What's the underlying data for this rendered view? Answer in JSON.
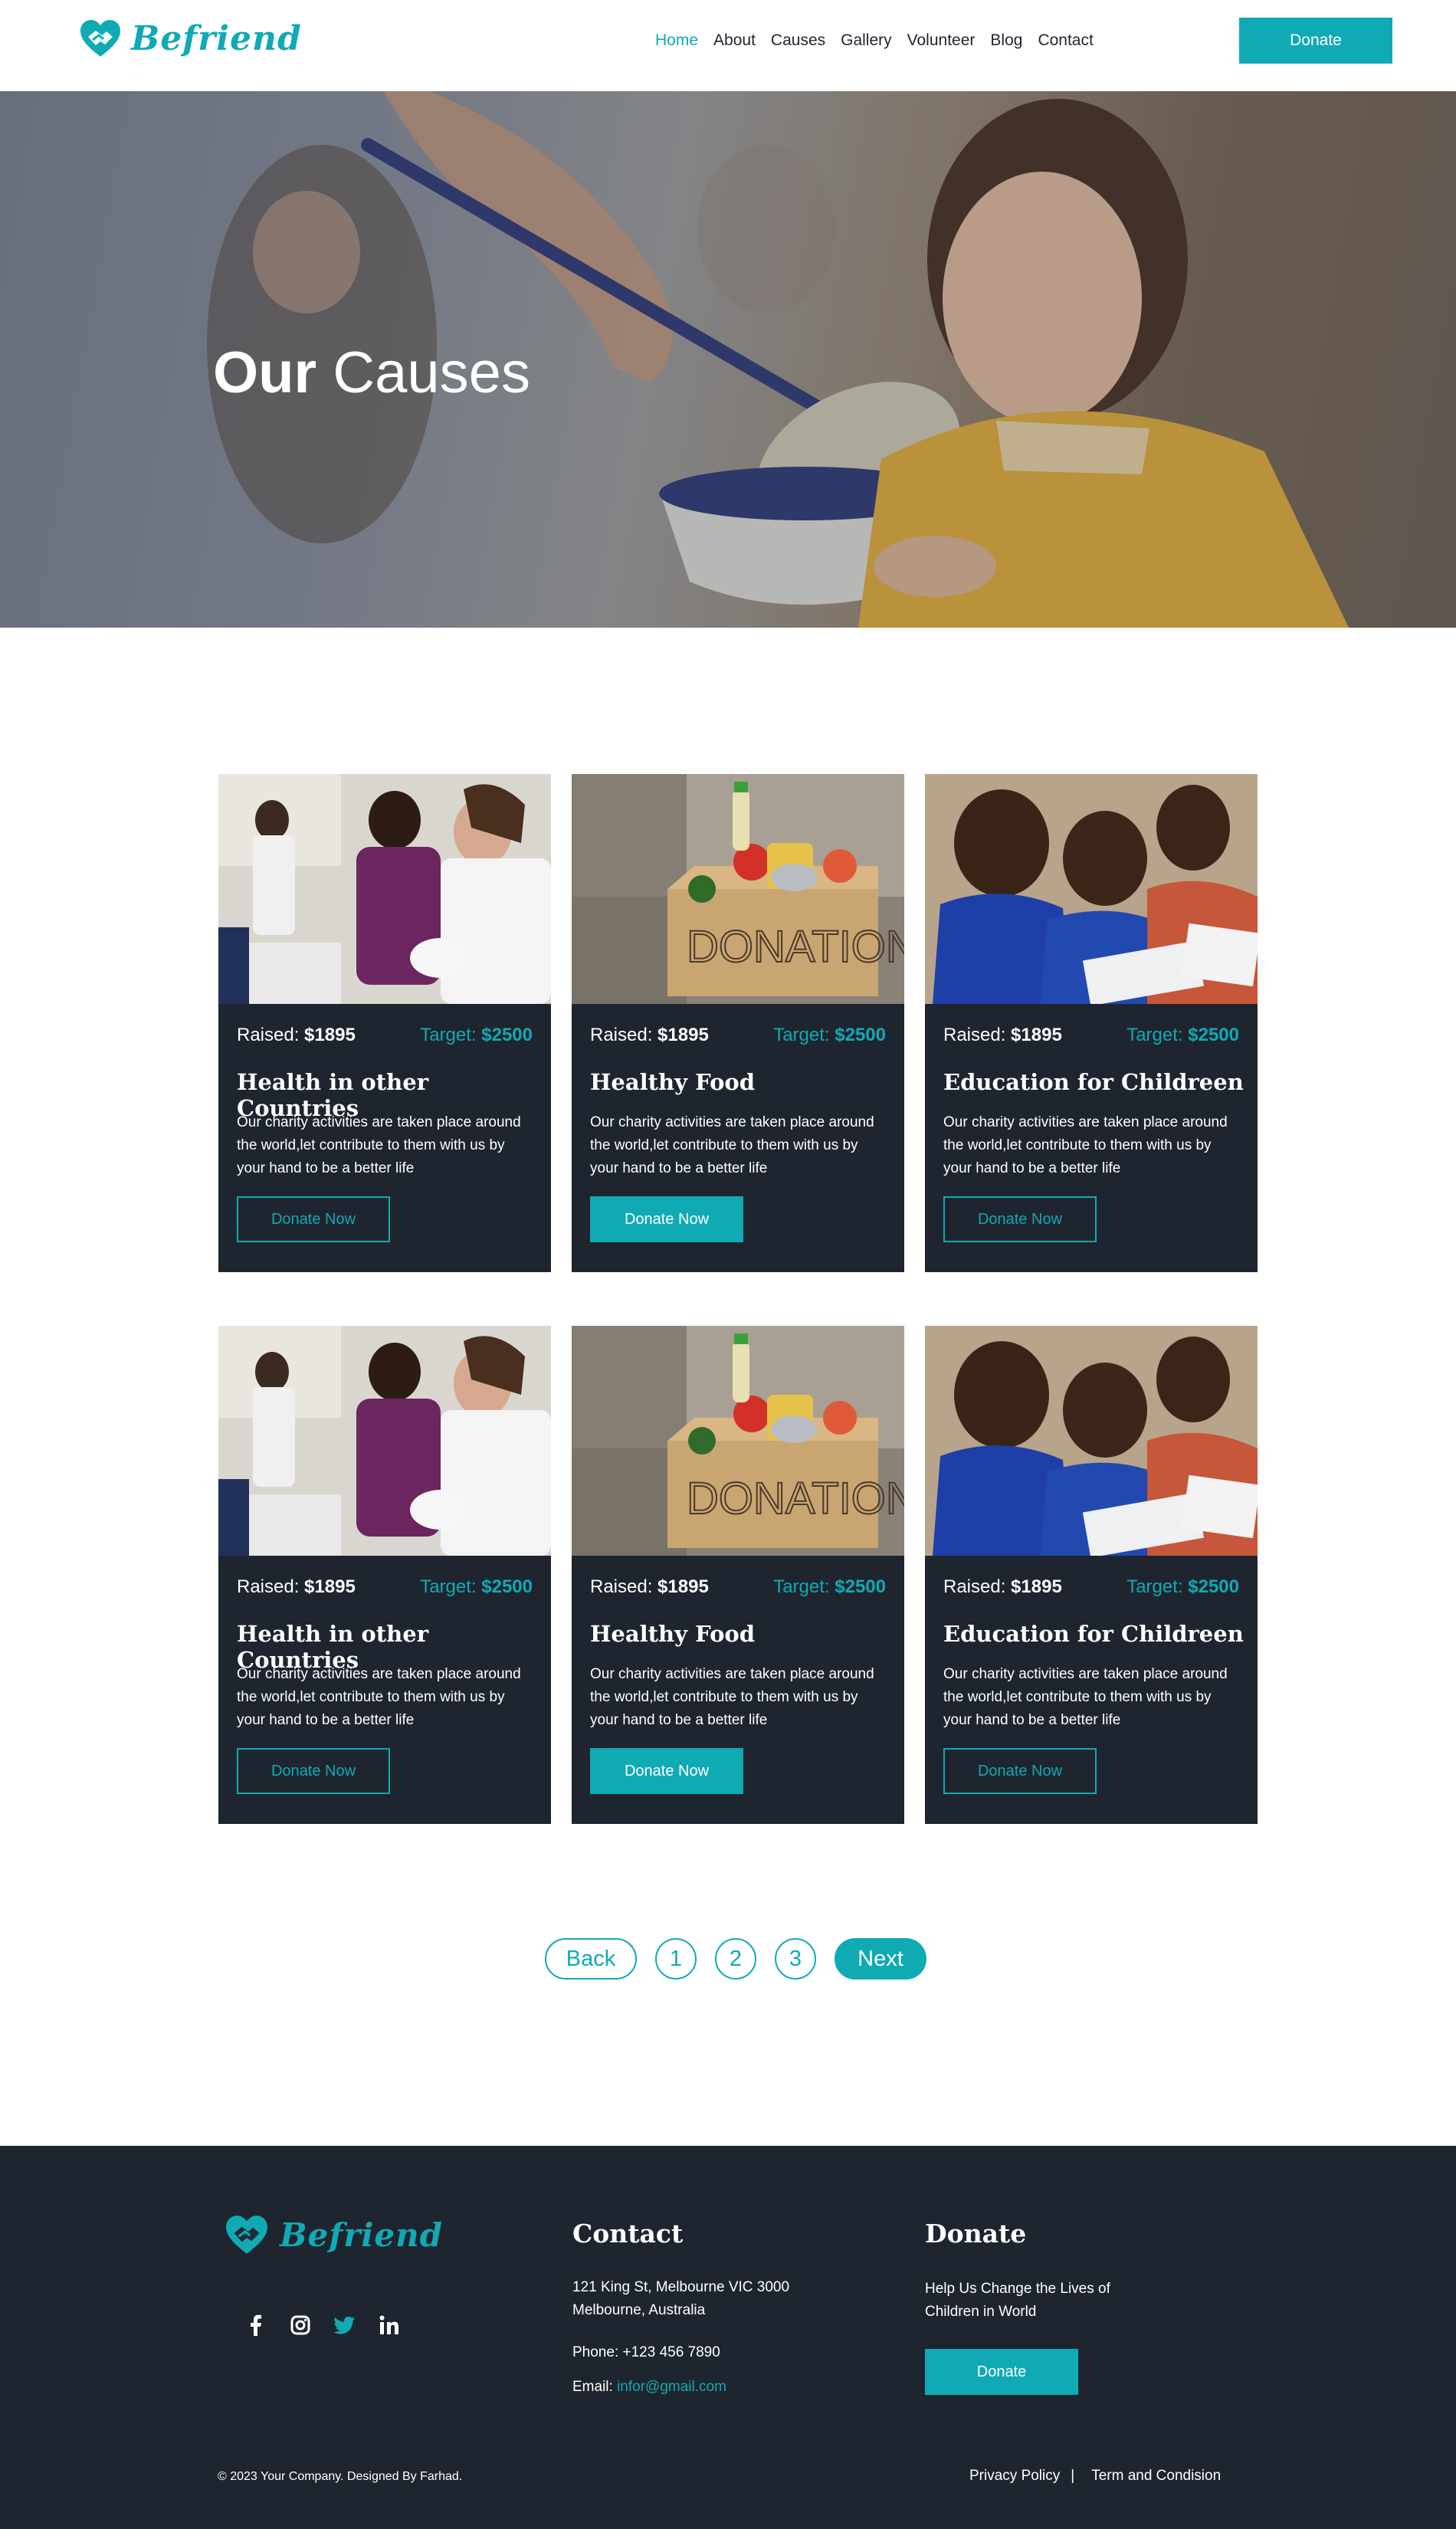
{
  "brand": {
    "name": "Befriend",
    "color": "#10aab5",
    "dark": "#1f252e"
  },
  "header": {
    "nav": [
      "Home",
      "About",
      "Causes",
      "Gallery",
      "Volunteer",
      "Blog",
      "Contact"
    ],
    "active_nav": "Home",
    "donate_label": "Donate"
  },
  "hero": {
    "title_bold": "Our",
    "title_light": "Causes"
  },
  "causes": [
    {
      "raised_label": "Raised:",
      "raised": "$1895",
      "target_label": "Target:",
      "target": "$2500",
      "title": "Health in other Countries",
      "desc": "Our charity activities are taken place around the world,let contribute to them with us by your hand to be a better life",
      "button": "Donate Now",
      "image": "health-photo"
    },
    {
      "raised_label": "Raised:",
      "raised": "$1895",
      "target_label": "Target:",
      "target": "$2500",
      "title": "Healthy Food",
      "desc": "Our charity activities are taken place around the world,let contribute to them with us by your hand to be a better life",
      "button": "Donate Now",
      "image": "food-donation-photo"
    },
    {
      "raised_label": "Raised:",
      "raised": "$1895",
      "target_label": "Target:",
      "target": "$2500",
      "title": "Education for Childreen",
      "desc": "Our charity activities are taken place around the world,let contribute to them with us by your hand to be a better life",
      "button": "Donate Now",
      "image": "children-education-photo"
    },
    {
      "raised_label": "Raised:",
      "raised": "$1895",
      "target_label": "Target:",
      "target": "$2500",
      "title": "Health in other Countries",
      "desc": "Our charity activities are taken place around the world,let contribute to them with us by your hand to be a better life",
      "button": "Donate Now",
      "image": "health-photo"
    },
    {
      "raised_label": "Raised:",
      "raised": "$1895",
      "target_label": "Target:",
      "target": "$2500",
      "title": "Healthy Food",
      "desc": "Our charity activities are taken place around the world,let contribute to them with us by your hand to be a better life",
      "button": "Donate Now",
      "image": "food-donation-photo"
    },
    {
      "raised_label": "Raised:",
      "raised": "$1895",
      "target_label": "Target:",
      "target": "$2500",
      "title": "Education for Childreen",
      "desc": "Our charity activities are taken place around the world,let contribute to them with us by your hand to be a better life",
      "button": "Donate Now",
      "image": "children-education-photo"
    }
  ],
  "pagination": {
    "back": "Back",
    "pages": [
      "1",
      "2",
      "3"
    ],
    "next": "Next"
  },
  "footer": {
    "social": [
      "facebook-icon",
      "instagram-icon",
      "twitter-icon",
      "linkedin-icon"
    ],
    "contact": {
      "title": "Contact",
      "address_line1": "121 King St, Melbourne VIC 3000",
      "address_line2": "Melbourne, Australia",
      "phone": "Phone: +123 456 7890",
      "email_label": "Email:",
      "email": "infor@gmail.com"
    },
    "donate": {
      "title": "Donate",
      "text_line1": "Help Us Change the Lives of",
      "text_line2": "Children in World",
      "button": "Donate"
    },
    "copyright": "© 2023 Your Company. Designed By Farhad.",
    "privacy": "Privacy Policy",
    "separator": "|",
    "terms": "Term and Condision"
  }
}
